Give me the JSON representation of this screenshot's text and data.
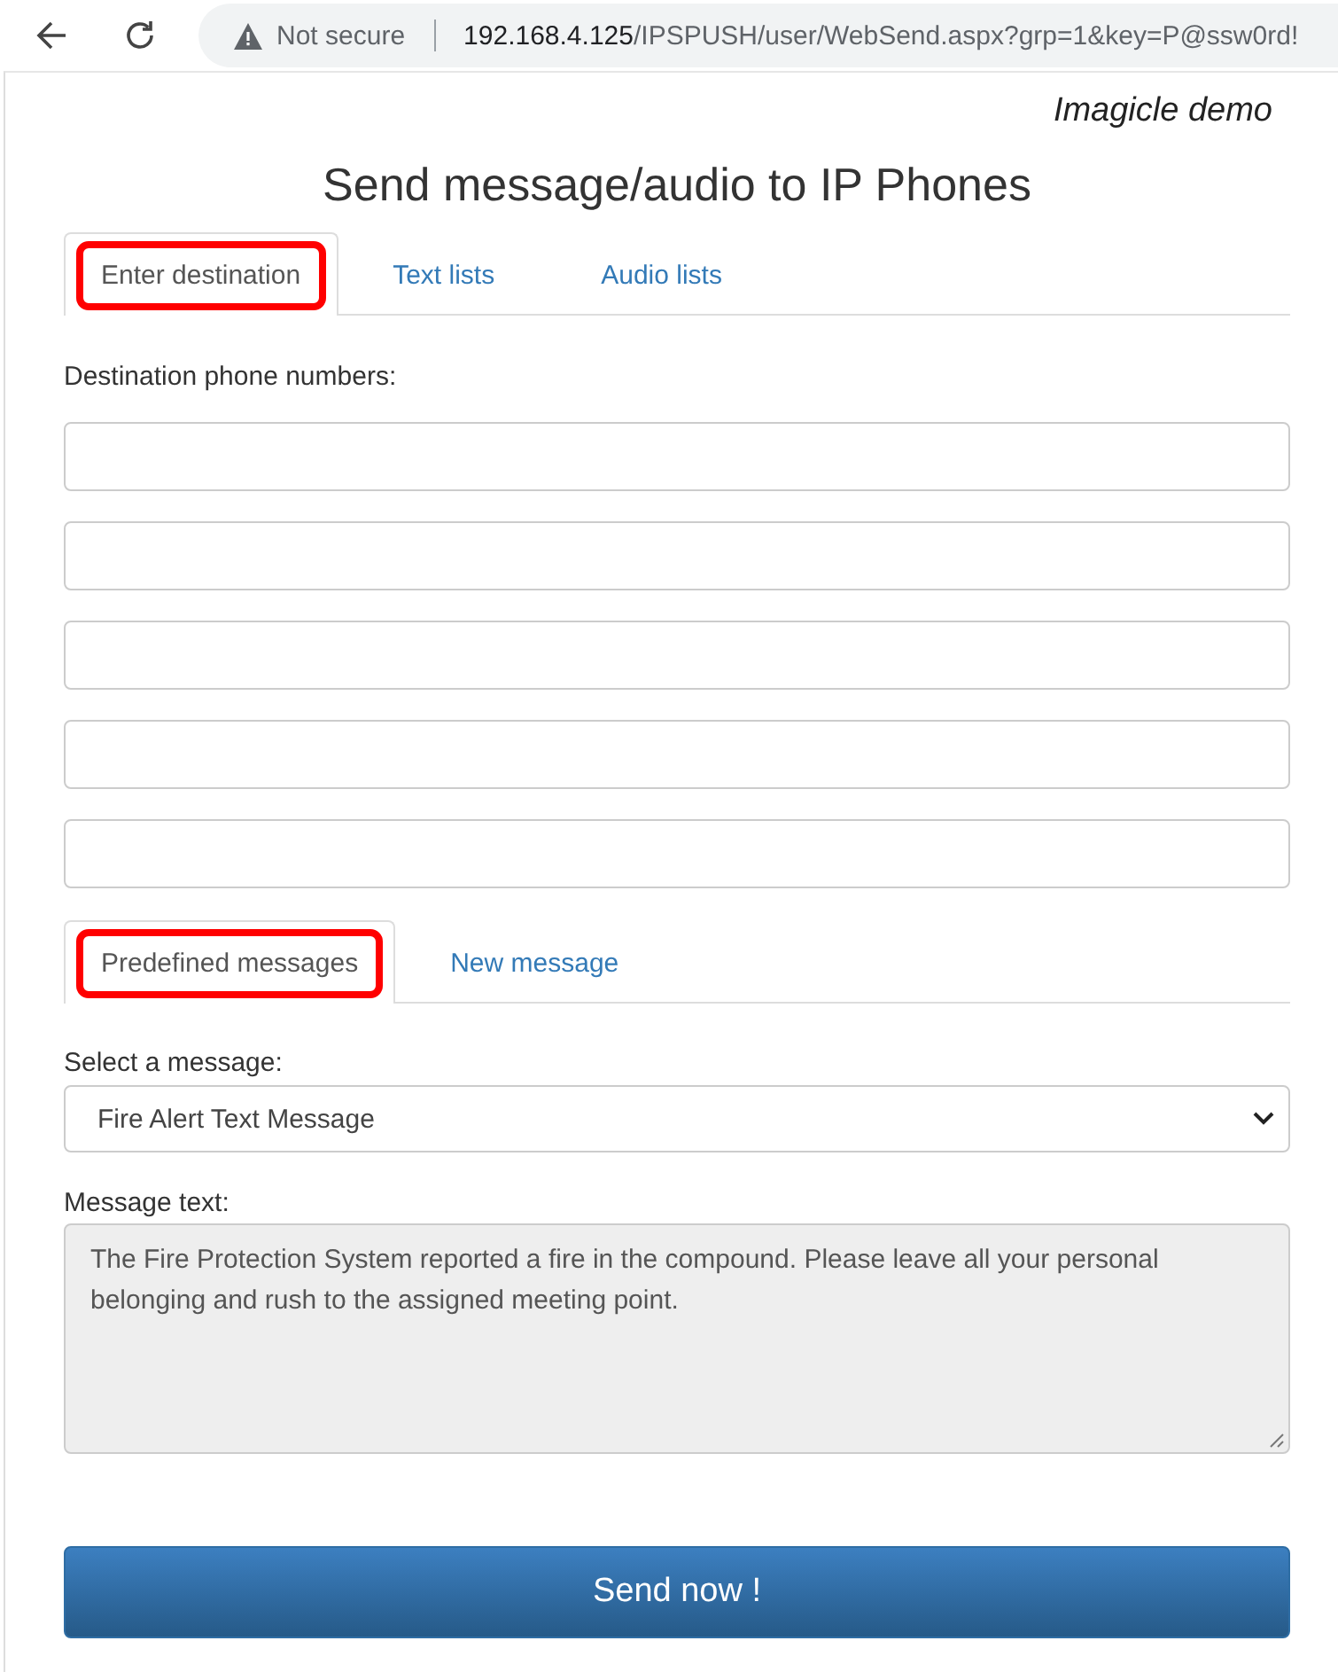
{
  "browser": {
    "security": "Not secure",
    "url_host": "192.168.4.125",
    "url_path": "/IPSPUSH/user/WebSend.aspx?grp=1&key=P@ssw0rd!"
  },
  "brand": "Imagicle demo",
  "title": "Send message/audio to IP Phones",
  "destination_tabs": [
    {
      "label": "Enter destination",
      "selected": true,
      "highlighted": true
    },
    {
      "label": "Text lists",
      "selected": false,
      "highlighted": false
    },
    {
      "label": "Audio lists",
      "selected": false,
      "highlighted": false
    }
  ],
  "destination_label": "Destination phone numbers:",
  "destination_fields": [
    {
      "kind": "text"
    },
    {
      "kind": "text"
    },
    {
      "kind": "text"
    },
    {
      "kind": "text"
    },
    {
      "kind": "text"
    }
  ],
  "message_tabs": [
    {
      "label": "Predefined messages",
      "selected": true,
      "highlighted": true
    },
    {
      "label": "New message",
      "selected": false,
      "highlighted": false
    }
  ],
  "select_label": "Select a message:",
  "select_value": "Fire Alert Text Message",
  "message_label": "Message text:",
  "message_text": "The Fire Protection System reported a fire in the compound. Please leave all your personal belonging and rush to the assigned meeting point.",
  "send_button": "Send now !"
}
